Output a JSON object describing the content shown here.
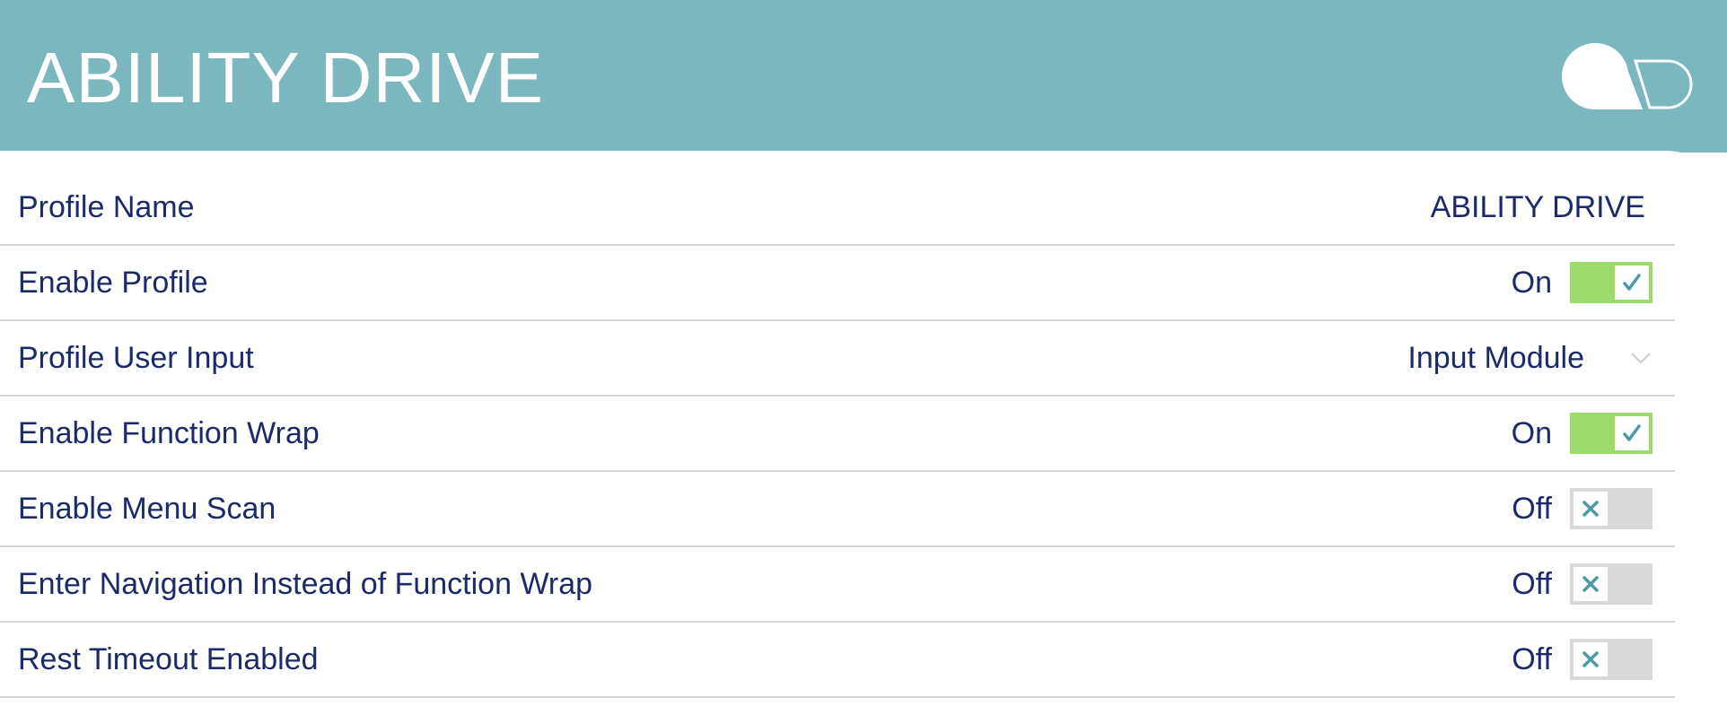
{
  "header": {
    "title": "ABILITY DRIVE",
    "background_color": "#7bb7bf",
    "logo_icon": "speech-bubble-logo-icon"
  },
  "rows": [
    {
      "label": "Profile Name",
      "type": "text",
      "value": "ABILITY DRIVE"
    },
    {
      "label": "Enable Profile",
      "type": "toggle",
      "state": "On",
      "checked": true
    },
    {
      "label": "Profile User Input",
      "type": "select",
      "value": "Input Module",
      "icon": "chevron-down-icon"
    },
    {
      "label": "Enable Function Wrap",
      "type": "toggle",
      "state": "On",
      "checked": true
    },
    {
      "label": "Enable Menu Scan",
      "type": "toggle",
      "state": "Off",
      "checked": false
    },
    {
      "label": "Enter Navigation Instead of Function Wrap",
      "type": "toggle",
      "state": "Off",
      "checked": false
    },
    {
      "label": "Rest Timeout Enabled",
      "type": "toggle",
      "state": "Off",
      "checked": false
    }
  ],
  "colors": {
    "text": "#1b2a6b",
    "toggle_on": "#9bdb6a",
    "toggle_off": "#d9d9d9",
    "icon_accent": "#4a9aa5",
    "divider": "#d6d6d6"
  }
}
